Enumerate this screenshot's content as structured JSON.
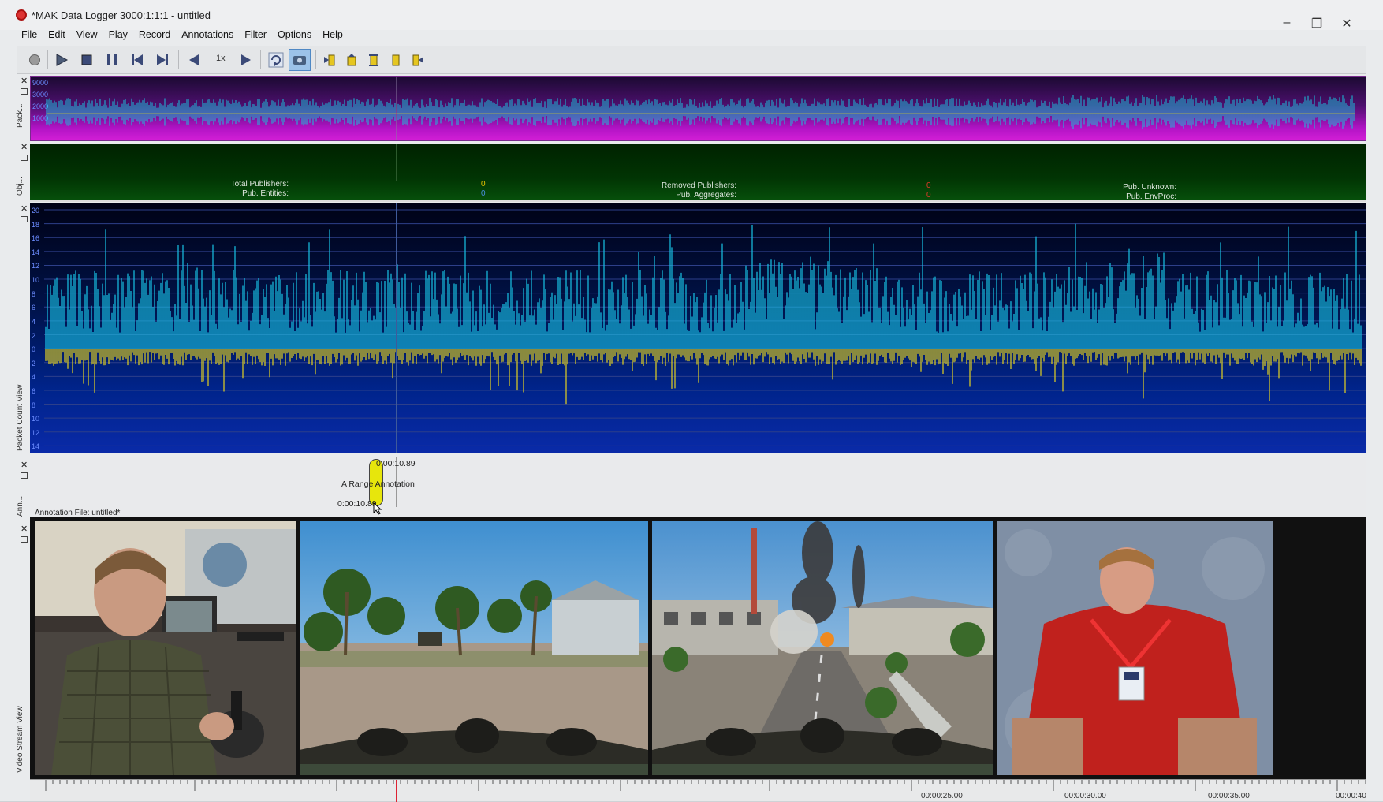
{
  "window": {
    "title": "*MAK Data Logger 3000:1:1:1 - untitled",
    "controls": {
      "minimize": "–",
      "restore": "❐",
      "close": "✕"
    }
  },
  "menu": [
    "File",
    "Edit",
    "View",
    "Play",
    "Record",
    "Annotations",
    "Filter",
    "Options",
    "Help"
  ],
  "toolbar": {
    "speed_label": "1x",
    "buttons": [
      "record-icon",
      "play-icon",
      "stop-icon",
      "pause-icon",
      "skip-start-icon",
      "skip-end-icon",
      "step-back-icon",
      "step-forward-icon",
      "loop-icon",
      "video-icon",
      "mark-in-icon",
      "annotation-icon",
      "range-icon",
      "bookmark-icon",
      "mark-out-icon"
    ]
  },
  "packet_view": {
    "side_label": "Pack...",
    "y_ticks": [
      "9000",
      "3000",
      "2000",
      "1000"
    ]
  },
  "object_view": {
    "side_label": "Obj...",
    "stats": [
      {
        "label": "Total Publishers:",
        "value": "0",
        "color": "#e6c300"
      },
      {
        "label": "Pub. Entities:",
        "value": "0",
        "color": "#4a8fe0"
      },
      {
        "label": "Removed Publishers:",
        "value": "0",
        "color": "#e23b2a"
      },
      {
        "label": "Pub. Aggregates:",
        "value": "0",
        "color": "#e23b2a"
      },
      {
        "label": "Pub. Unknown:",
        "value": "",
        "color": "#ffffff"
      },
      {
        "label": "Pub. EnvProc:",
        "value": "",
        "color": "#ffffff"
      }
    ]
  },
  "packet_count_view": {
    "side_label": "Packet Count View",
    "y_ticks": [
      "20",
      "18",
      "16",
      "14",
      "12",
      "10",
      "8",
      "6",
      "4",
      "2",
      "0",
      "2",
      "4",
      "6",
      "8",
      "10",
      "12",
      "14"
    ],
    "colors": {
      "positive": "#17c4e6",
      "negative": "#e4d31f"
    }
  },
  "annotation_view": {
    "side_label": "Ann...",
    "time_top": "0:00:10.89",
    "label": "A Range Annotation",
    "time_bottom": "0:00:10.89",
    "file_label": "Annotation File: untitled*"
  },
  "video_view": {
    "side_label": "Video Stream View",
    "frames": [
      "operator-cam",
      "sim-view-beach",
      "sim-view-town",
      "presenter-cam"
    ]
  },
  "timeline": {
    "labels": [
      "00:00:25.00",
      "00:00:30.00",
      "00:00:35.00",
      "00:00:40.00"
    ]
  }
}
